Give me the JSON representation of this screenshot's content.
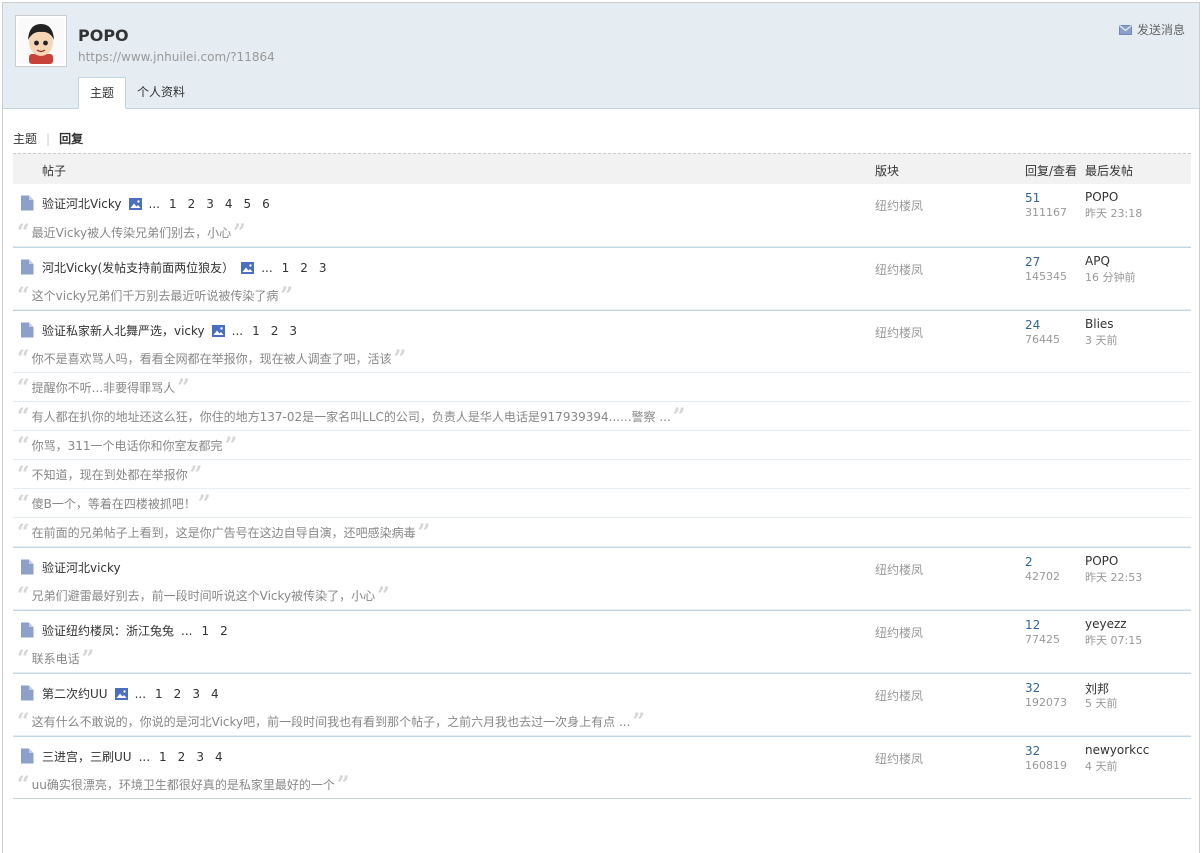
{
  "profile": {
    "username": "POPO",
    "url": "https://www.jnhuilei.com/?11864",
    "send_message": "发送消息",
    "tabs": [
      "主题",
      "个人资料"
    ]
  },
  "subnav": {
    "topics": "主题",
    "replies": "回复"
  },
  "table": {
    "headers": {
      "post": "帖子",
      "forum": "版块",
      "replies_views": "回复/查看",
      "last_post": "最后发帖"
    },
    "threads": [
      {
        "title": "验证河北Vicky",
        "image": true,
        "ellipsis": "...",
        "pages": [
          "1",
          "2",
          "3",
          "4",
          "5",
          "6"
        ],
        "forum": "纽约楼凤",
        "replies": "51",
        "views": "311167",
        "last_user": "POPO",
        "last_time": "昨天 23:18",
        "quotes": [
          "最近Vicky被人传染兄弟们别去，小心"
        ]
      },
      {
        "title": "河北Vicky(发帖支持前面两位狼友）",
        "image": true,
        "ellipsis": "...",
        "pages": [
          "1",
          "2",
          "3"
        ],
        "forum": "纽约楼凤",
        "replies": "27",
        "views": "145345",
        "last_user": "APQ",
        "last_time": "16 分钟前",
        "quotes": [
          "这个vicky兄弟们千万别去最近听说被传染了病"
        ]
      },
      {
        "title": "验证私家新人北舞严选，vicky",
        "image": true,
        "ellipsis": "...",
        "pages": [
          "1",
          "2",
          "3"
        ],
        "forum": "纽约楼凤",
        "replies": "24",
        "views": "76445",
        "last_user": "Blies",
        "last_time": "3 天前",
        "quotes": [
          "你不是喜欢骂人吗，看看全网都在举报你，现在被人调查了吧，活该",
          "提醒你不听...非要得罪骂人",
          "有人都在扒你的地址还这么狂，你住的地方137-02是一家名叫LLC的公司，负责人是华人电话是917939394......警察 ...",
          "你骂，311一个电话你和你室友都完",
          "不知道，现在到处都在举报你",
          "傻B一个，等着在四楼被抓吧！",
          "在前面的兄弟帖子上看到，这是你广告号在这边自导自演，还吧感染病毒"
        ]
      },
      {
        "title": "验证河北vicky",
        "image": false,
        "ellipsis": "",
        "pages": [],
        "forum": "纽约楼凤",
        "replies": "2",
        "views": "42702",
        "last_user": "POPO",
        "last_time": "昨天 22:53",
        "quotes": [
          "兄弟们避雷最好别去，前一段时间听说这个Vicky被传染了，小心"
        ]
      },
      {
        "title": "验证纽约楼凤：浙江兔兔",
        "image": false,
        "ellipsis": "...",
        "pages": [
          "1",
          "2"
        ],
        "forum": "纽约楼凤",
        "replies": "12",
        "views": "77425",
        "last_user": "yeyezz",
        "last_time": "昨天 07:15",
        "quotes": [
          "联系电话"
        ]
      },
      {
        "title": "第二次约UU",
        "image": true,
        "ellipsis": "...",
        "pages": [
          "1",
          "2",
          "3",
          "4"
        ],
        "forum": "纽约楼凤",
        "replies": "32",
        "views": "192073",
        "last_user": "刘邦",
        "last_time": "5 天前",
        "quotes": [
          "这有什么不敢说的，你说的是河北Vicky吧，前一段时间我也有看到那个帖子，之前六月我也去过一次身上有点 ..."
        ]
      },
      {
        "title": "三进宫，三刷UU",
        "image": false,
        "ellipsis": "...",
        "pages": [
          "1",
          "2",
          "3",
          "4"
        ],
        "forum": "纽约楼凤",
        "replies": "32",
        "views": "160819",
        "last_user": "newyorkcc",
        "last_time": "4 天前",
        "quotes": [
          "uu确实很漂亮，环境卫生都很好真的是私家里最好的一个"
        ]
      }
    ]
  },
  "colors": {
    "header_bg": "#e5edf2",
    "border": "#c2d5e3",
    "link": "#336699",
    "muted": "#999999"
  },
  "icons": {
    "avatar": "cartoon-avatar",
    "send": "envelope-icon",
    "thread": "file-icon",
    "image": "image-icon",
    "quote": "quote-mark-icon"
  }
}
